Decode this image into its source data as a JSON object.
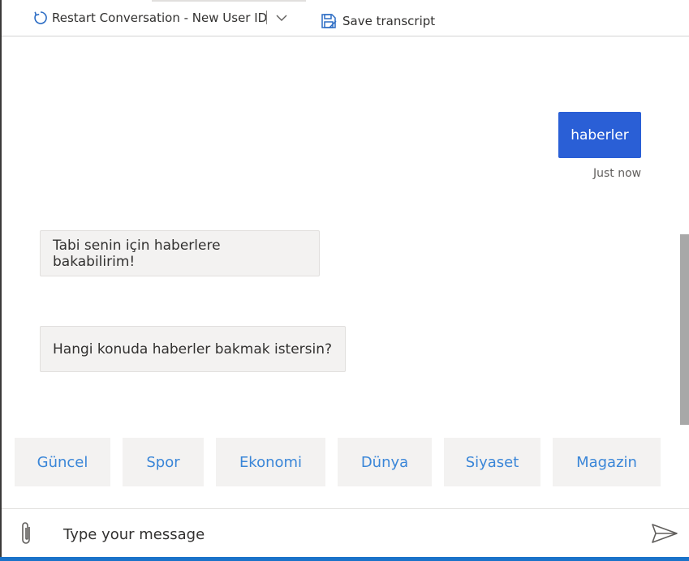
{
  "toolbar": {
    "restart_label": "Restart Conversation - New User ID",
    "save_label": "Save transcript",
    "restart_icon": "refresh-icon",
    "dropdown_icon": "chevron-down-icon",
    "save_icon": "save-icon"
  },
  "messages": {
    "user": [
      {
        "text": "haberler",
        "timestamp": "Just now"
      }
    ],
    "bot": [
      {
        "text": "Tabi senin için haberlere bakabilirim!"
      },
      {
        "text": "Hangi konuda haberler bakmak istersin?"
      }
    ]
  },
  "suggested_actions": [
    "Güncel",
    "Spor",
    "Ekonomi",
    "Dünya",
    "Siyaset",
    "Magazin"
  ],
  "input": {
    "placeholder": "Type your message",
    "value": "",
    "attach_icon": "paperclip-icon",
    "send_icon": "send-icon"
  },
  "colors": {
    "user_bubble": "#2a5fd6",
    "bot_bubble": "#f3f2f1",
    "suggestion_text": "#3a86d8",
    "bottom_accent": "#1a73c9"
  }
}
